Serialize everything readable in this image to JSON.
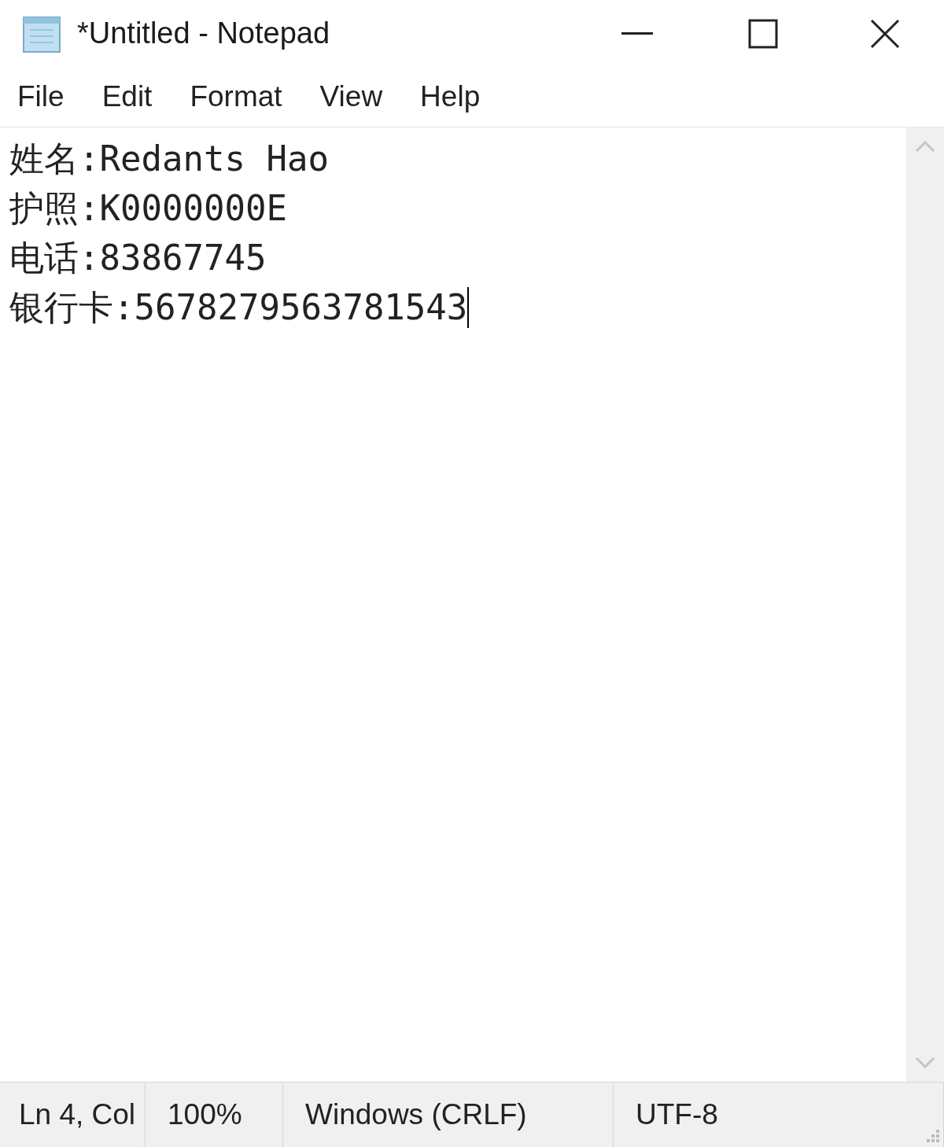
{
  "window": {
    "title": "*Untitled - Notepad"
  },
  "menu": [
    {
      "label": "File"
    },
    {
      "label": "Edit"
    },
    {
      "label": "Format"
    },
    {
      "label": "View"
    },
    {
      "label": "Help"
    }
  ],
  "editor": {
    "lines": [
      "姓名:Redants Hao",
      "护照:K0000000E",
      "电话:83867745",
      "银行卡:5678279563781543"
    ]
  },
  "status_bar": [
    {
      "text": "Ln 4, Col"
    },
    {
      "text": "100%"
    },
    {
      "text": "Windows (CRLF)"
    },
    {
      "text": "UTF-8"
    }
  ]
}
